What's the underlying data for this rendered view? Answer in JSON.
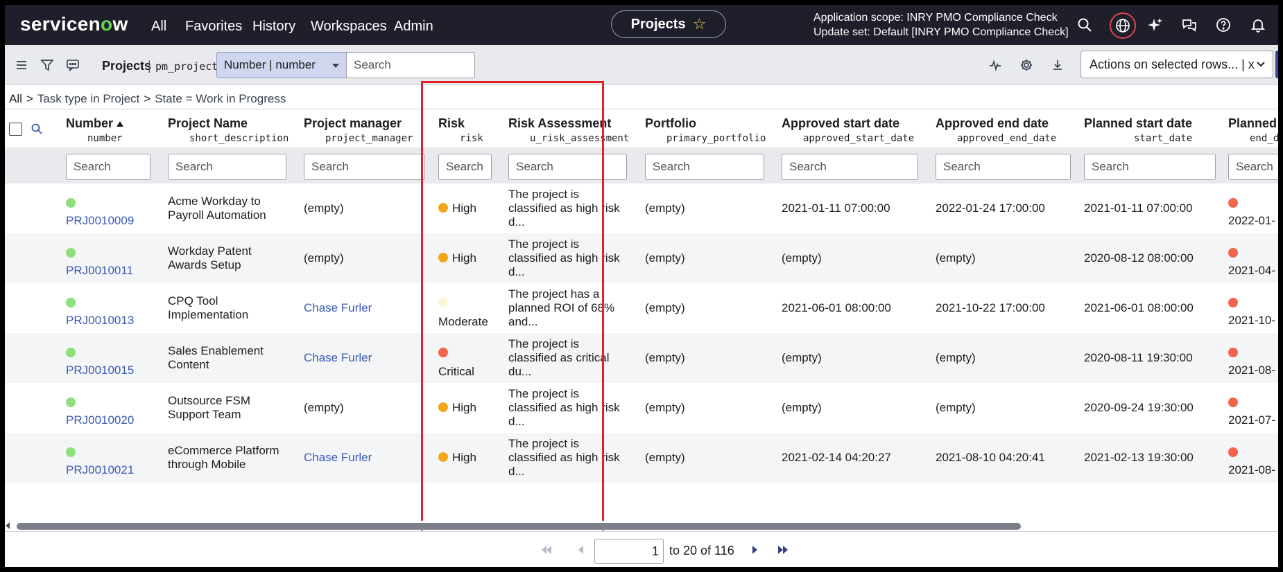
{
  "nav": {
    "logo": "servicenow",
    "items": [
      "All",
      "Favorites",
      "History",
      "Workspaces",
      "Admin"
    ],
    "projects_pill": "Projects",
    "scope_line1": "Application scope: INRY PMO Compliance Check",
    "scope_line2": "Update set: Default [INRY PMO Compliance Check]",
    "icons": [
      "search-icon",
      "globe-icon",
      "sparkle-icon",
      "chat-icon",
      "help-icon",
      "bell-icon"
    ]
  },
  "toolbar": {
    "title": "Projects",
    "separator": "|",
    "table_name": "pm_project",
    "field_select": "Number | number",
    "search_placeholder": "Search",
    "actions_select": "Actions on selected rows... | x"
  },
  "breadcrumb": {
    "root": "All",
    "crumbs": [
      "Task type in Project",
      "State = Work in Progress"
    ]
  },
  "columns": [
    {
      "label": "Number",
      "field": "number",
      "sorted": "asc"
    },
    {
      "label": "Project Name",
      "field": "short_description"
    },
    {
      "label": "Project manager",
      "field": "project_manager"
    },
    {
      "label": "Risk",
      "field": "risk"
    },
    {
      "label": "Risk Assessment",
      "field": "u_risk_assessment"
    },
    {
      "label": "Portfolio",
      "field": "primary_portfolio"
    },
    {
      "label": "Approved start date",
      "field": "approved_start_date"
    },
    {
      "label": "Approved end date",
      "field": "approved_end_date"
    },
    {
      "label": "Planned start date",
      "field": "start_date"
    },
    {
      "label": "Planned e",
      "field": "end_d"
    }
  ],
  "column_search_placeholder": "Search",
  "rows": [
    {
      "number": "PRJ0010009",
      "name1": "Acme Workday to",
      "name2": "Payroll Automation",
      "manager": "(empty)",
      "manager_link": false,
      "risk": "High",
      "risk_color": "orange",
      "ra1": "The project is",
      "ra2": "classified as high risk",
      "ra3": "d...",
      "portfolio": "(empty)",
      "approved_start": "2021-01-11 07:00:00",
      "approved_end": "2022-01-24 17:00:00",
      "planned_start": "2021-01-11 07:00:00",
      "planned_end": "2022-01-"
    },
    {
      "number": "PRJ0010011",
      "name1": "Workday Patent",
      "name2": "Awards Setup",
      "manager": "(empty)",
      "manager_link": false,
      "risk": "High",
      "risk_color": "orange",
      "ra1": "The project is",
      "ra2": "classified as high risk",
      "ra3": "d...",
      "portfolio": "(empty)",
      "approved_start": "(empty)",
      "approved_end": "(empty)",
      "planned_start": "2020-08-12 08:00:00",
      "planned_end": "2021-04-"
    },
    {
      "number": "PRJ0010013",
      "name1": "CPQ Tool",
      "name2": "Implementation",
      "manager": "Chase Furler",
      "manager_link": true,
      "risk": "Moderate",
      "risk_color": "pale",
      "ra1": "The project has a",
      "ra2": "planned ROI of 68%",
      "ra3": "and...",
      "portfolio": "(empty)",
      "approved_start": "2021-06-01 08:00:00",
      "approved_end": "2021-10-22 17:00:00",
      "planned_start": "2021-06-01 08:00:00",
      "planned_end": "2021-10-"
    },
    {
      "number": "PRJ0010015",
      "name1": "Sales Enablement",
      "name2": "Content",
      "manager": "Chase Furler",
      "manager_link": true,
      "risk": "Critical",
      "risk_color": "red",
      "ra1": "The project is",
      "ra2": "classified as critical",
      "ra3": "du...",
      "portfolio": "(empty)",
      "approved_start": "(empty)",
      "approved_end": "(empty)",
      "planned_start": "2020-08-11 19:30:00",
      "planned_end": "2021-08-"
    },
    {
      "number": "PRJ0010020",
      "name1": "Outsource FSM",
      "name2": "Support Team",
      "manager": "(empty)",
      "manager_link": false,
      "risk": "High",
      "risk_color": "orange",
      "ra1": "The project is",
      "ra2": "classified as high risk",
      "ra3": "d...",
      "portfolio": "(empty)",
      "approved_start": "(empty)",
      "approved_end": "(empty)",
      "planned_start": "2020-09-24 19:30:00",
      "planned_end": "2021-07-"
    },
    {
      "number": "PRJ0010021",
      "name1": "eCommerce Platform",
      "name2": "through Mobile",
      "manager": "Chase Furler",
      "manager_link": true,
      "risk": "High",
      "risk_color": "orange",
      "ra1": "The project is",
      "ra2": "classified as high risk",
      "ra3": "d...",
      "portfolio": "(empty)",
      "approved_start": "2021-02-14 04:20:27",
      "approved_end": "2021-08-10 04:20:41",
      "planned_start": "2021-02-13 19:30:00",
      "planned_end": "2021-08-"
    }
  ],
  "pager": {
    "page": "1",
    "range": "to 20 of 116"
  },
  "colors": {
    "nav_bg": "#1f1f2b",
    "link": "#3c5bb5",
    "highlight": "#e0222a",
    "status_green": "#8ee07a",
    "risk_high": "#f2a71b",
    "risk_moderate": "#fbf6d8",
    "risk_critical": "#f2654b"
  }
}
